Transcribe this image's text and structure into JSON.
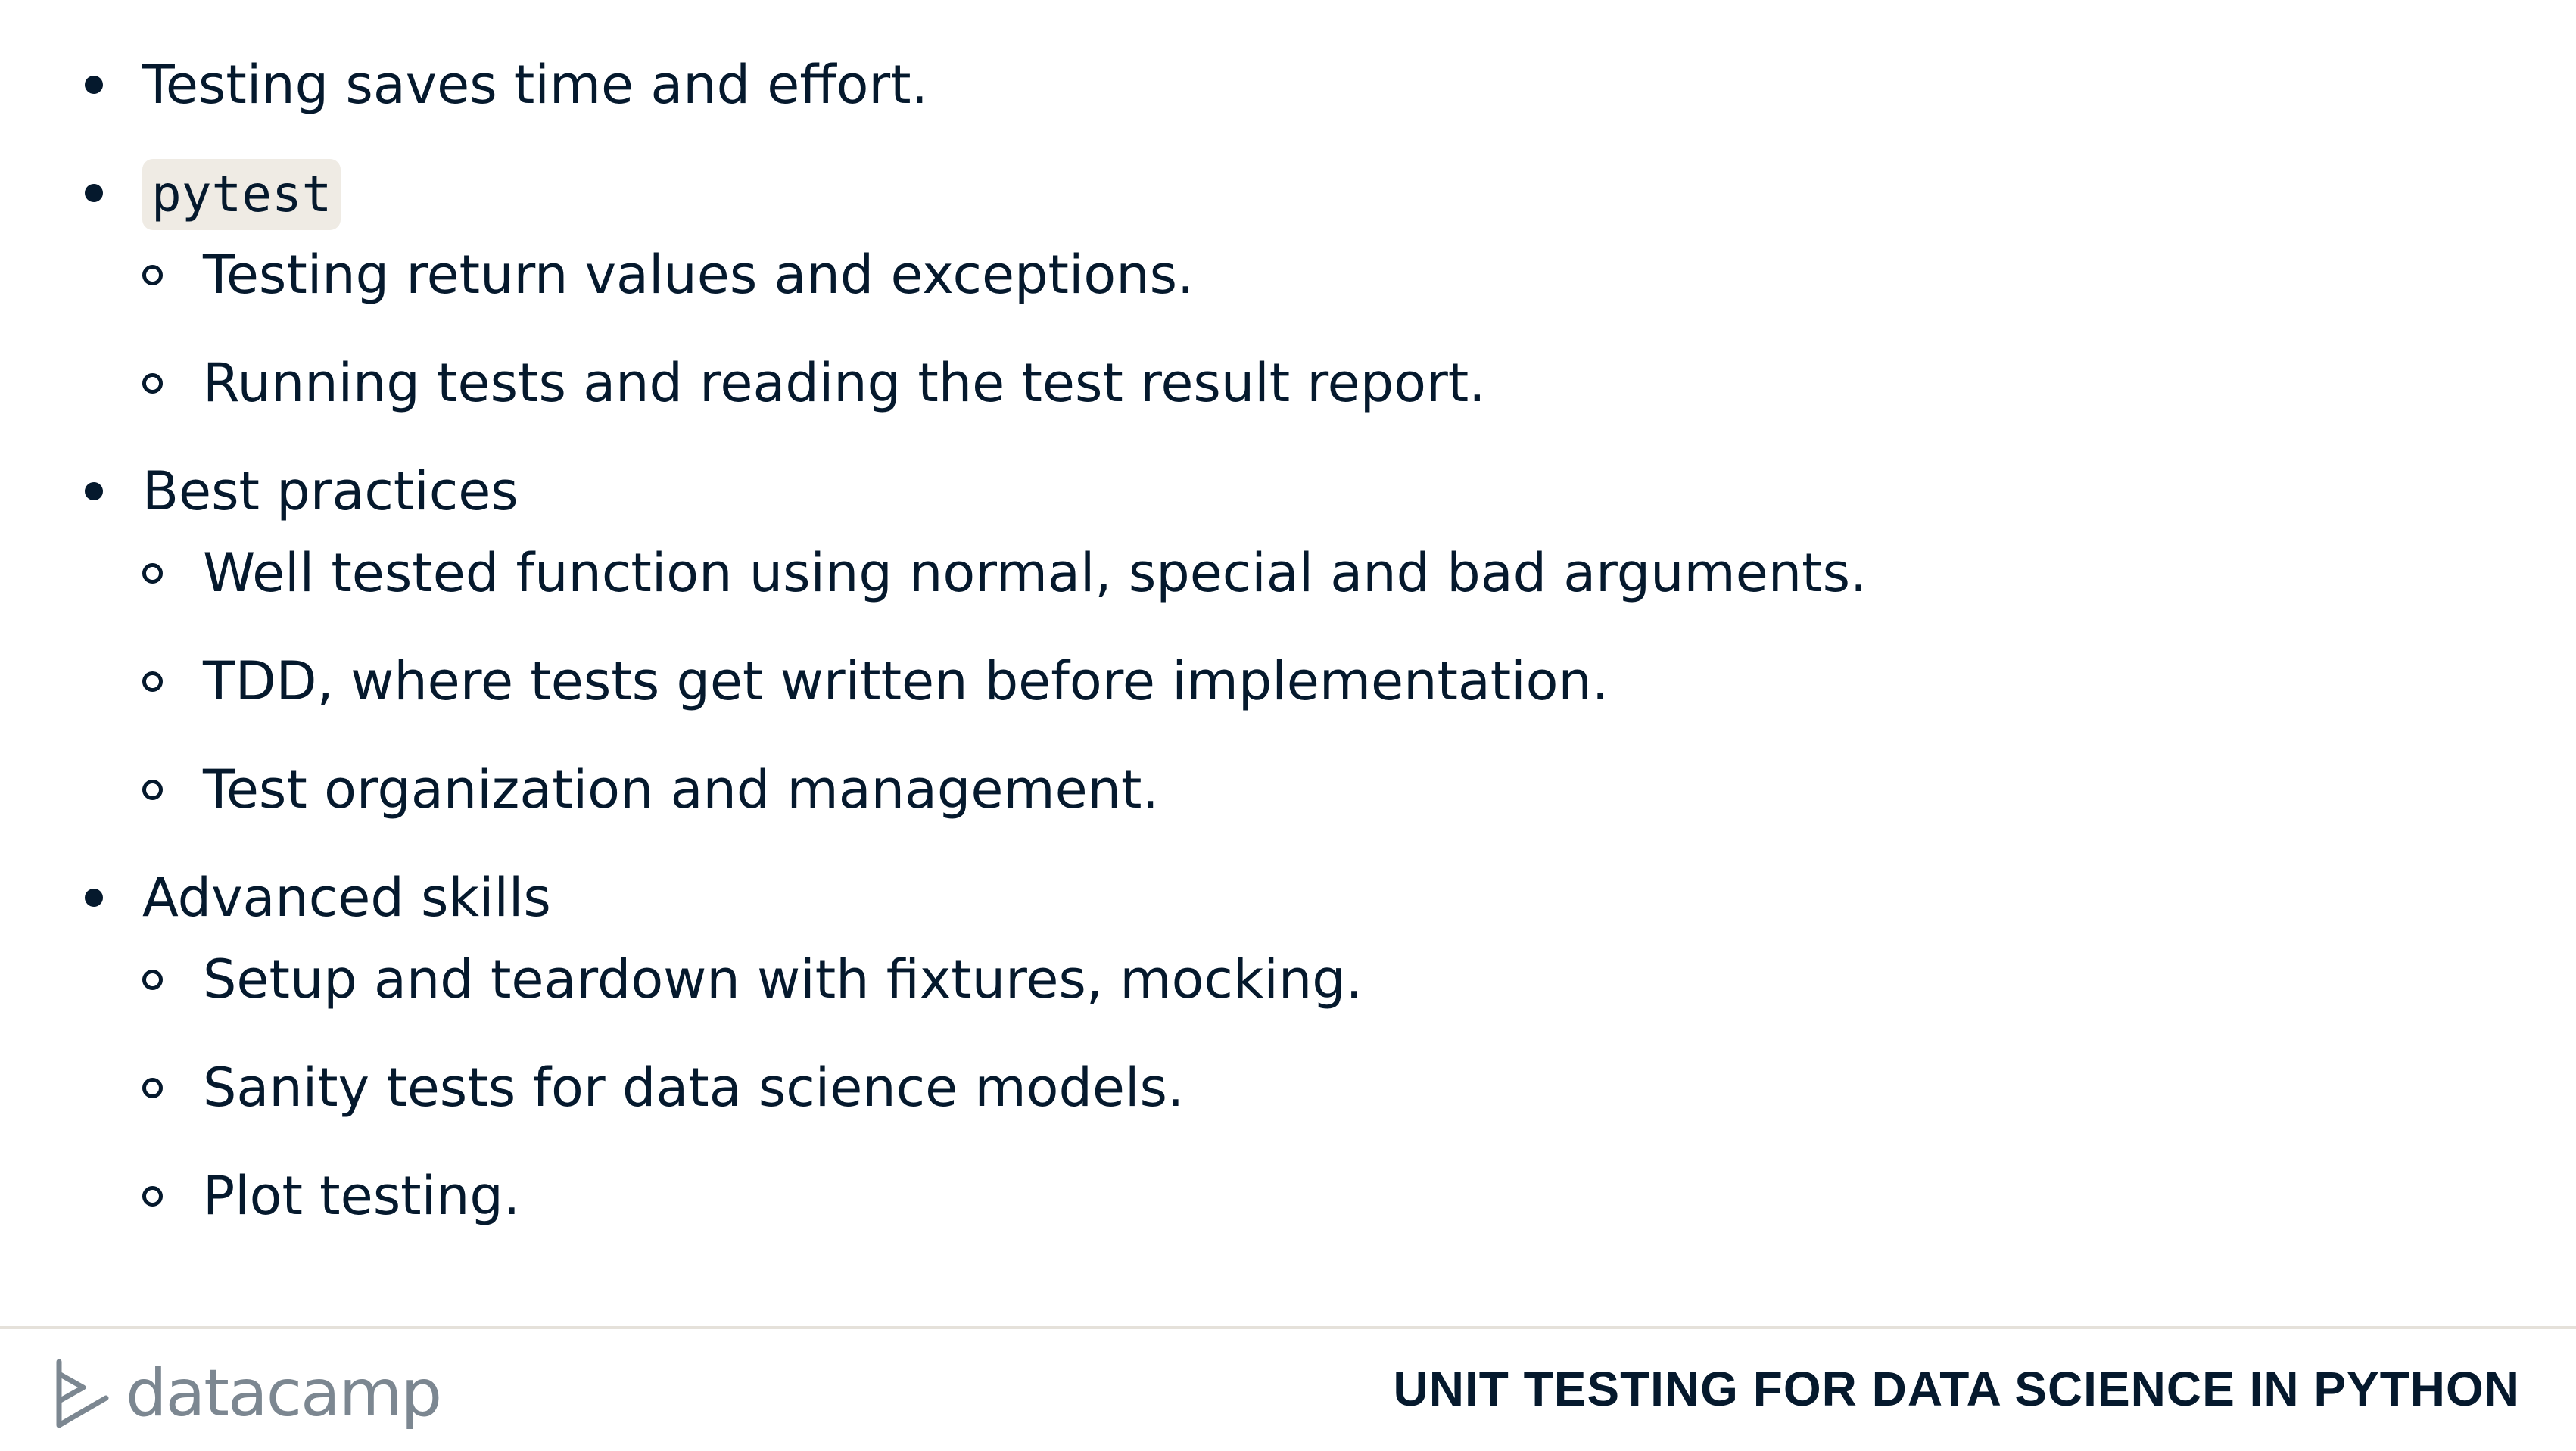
{
  "bullets": [
    {
      "text": "Testing saves time and effort."
    },
    {
      "code": "pytest",
      "children": [
        "Testing return values and exceptions.",
        "Running tests and reading the test result report."
      ]
    },
    {
      "text": "Best practices",
      "children": [
        "Well tested function using normal, special and bad arguments.",
        "TDD, where tests get written before implementation.",
        "Test organization and management."
      ]
    },
    {
      "text": "Advanced skills",
      "children": [
        "Setup and teardown with fixtures, mocking.",
        "Sanity tests for data science models.",
        "Plot testing."
      ]
    }
  ],
  "footer": {
    "logo_text": "datacamp",
    "logo_icon": "datacamp-logo-icon",
    "course_title": "UNIT TESTING FOR DATA SCIENCE IN PYTHON"
  },
  "colors": {
    "text": "#05192d",
    "code_background": "#efebe4",
    "logo_gray": "#7c8791",
    "divider": "#e5e1da"
  }
}
